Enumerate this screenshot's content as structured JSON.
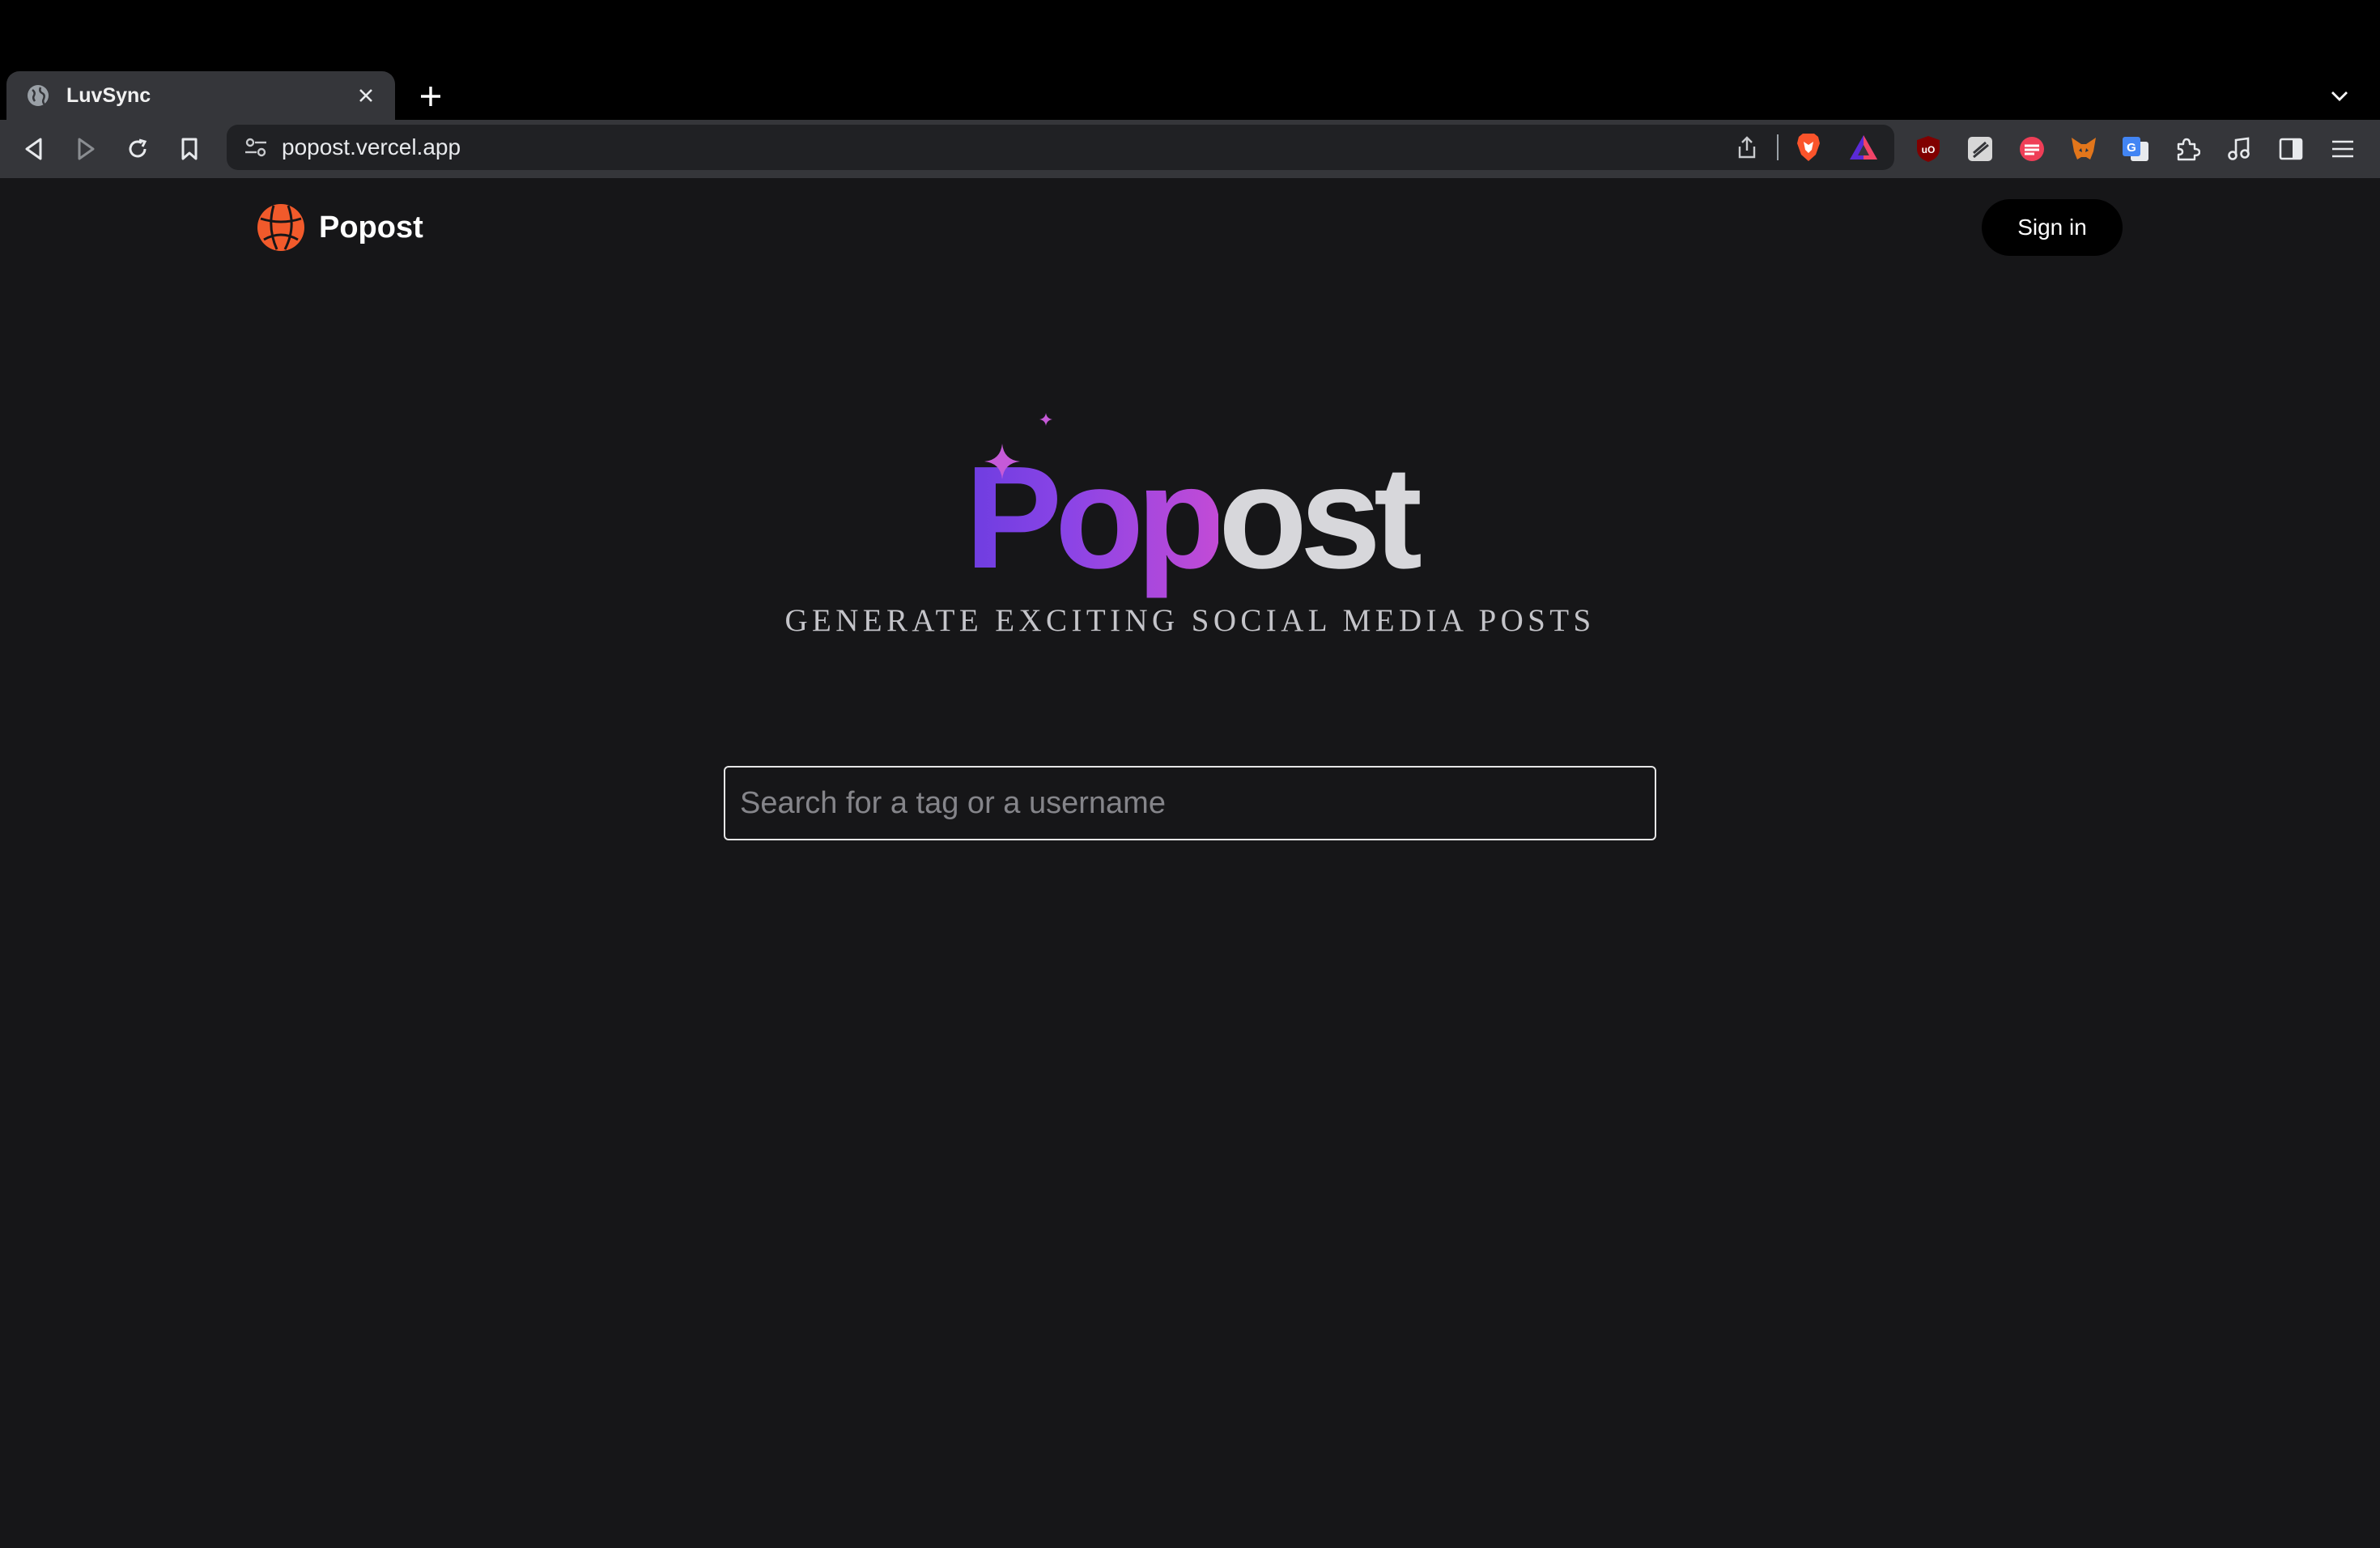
{
  "browser": {
    "tab": {
      "title": "LuvSync",
      "favicon": "globe-icon"
    },
    "omnibox": {
      "url": "popost.vercel.app"
    },
    "extensions": [
      "ublock-icon",
      "notes-icon",
      "stripe-icon",
      "metamask-icon",
      "translate-icon",
      "puzzle-icon",
      "music-icon",
      "sidebar-icon",
      "menu-icon"
    ]
  },
  "page": {
    "brand": {
      "name": "Popost"
    },
    "signin_label": "Sign in",
    "hero": {
      "gradient_part": "Pop",
      "rest_part": "ost"
    },
    "tagline": "GENERATE EXCITING SOCIAL MEDIA POSTS",
    "search": {
      "placeholder": "Search for a tag or a username",
      "value": ""
    }
  },
  "colors": {
    "page_bg": "#161618",
    "brand_orange": "#f15a2b",
    "hero_gradient_start": "#6d3de0",
    "hero_gradient_end": "#c24bd6"
  }
}
